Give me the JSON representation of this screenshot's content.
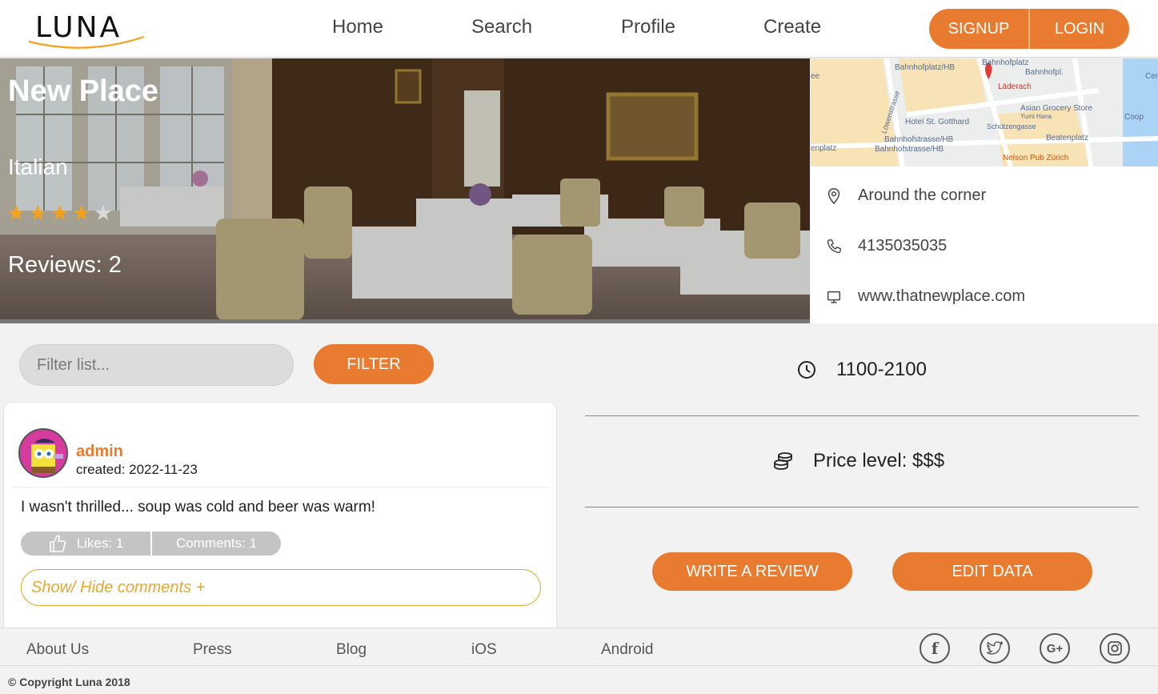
{
  "app": {
    "logo_text": "LUNA"
  },
  "nav": {
    "home": "Home",
    "search": "Search",
    "profile": "Profile",
    "create": "Create"
  },
  "auth": {
    "signup": "SIGNUP",
    "login": "LOGIN"
  },
  "restaurant": {
    "name": "New Place",
    "cuisine": "Italian",
    "rating": 4,
    "rating_max": 5,
    "reviews_label": "Reviews: 2",
    "address": "Around the corner",
    "phone": "4135035035",
    "website": "www.thatnewplace.com",
    "hours": "1100-2100",
    "price_level": "Price level: $$$"
  },
  "map": {
    "labels": [
      "Bahnhofplatz/HB",
      "Bahnhofplatz",
      "Bahnhofpl.",
      "Läderach",
      "Asian Grocery Store",
      "Yumi Hana",
      "Hotel St. Gotthard",
      "Schützengasse",
      "Coop",
      "Bahnhofstrasse/HB",
      "Bahnhofstrasse/HB",
      "Beatenplatz",
      "Nelson Pub Zürich",
      "Löwenstrasse",
      "enplatz",
      "ee",
      "Cen"
    ]
  },
  "filter": {
    "placeholder": "Filter list...",
    "button": "FILTER"
  },
  "review": {
    "username": "admin",
    "created": "created: 2022-11-23",
    "text": "I wasn't thrilled... soup was cold and beer was warm!",
    "likes": "Likes: 1",
    "comments": "Comments: 1",
    "toggle": "Show/ Hide comments +"
  },
  "actions": {
    "write_review": "WRITE A REVIEW",
    "edit_data": "EDIT DATA"
  },
  "footer": {
    "links": [
      "About Us",
      "Press",
      "Blog",
      "iOS",
      "Android"
    ],
    "social": [
      "f",
      "t",
      "G+",
      "ig"
    ],
    "copyright": "© Copyright Luna 2018"
  },
  "colors": {
    "accent": "#e87b2f",
    "toggle": "#e6a82e",
    "star": "#f4a21c"
  }
}
